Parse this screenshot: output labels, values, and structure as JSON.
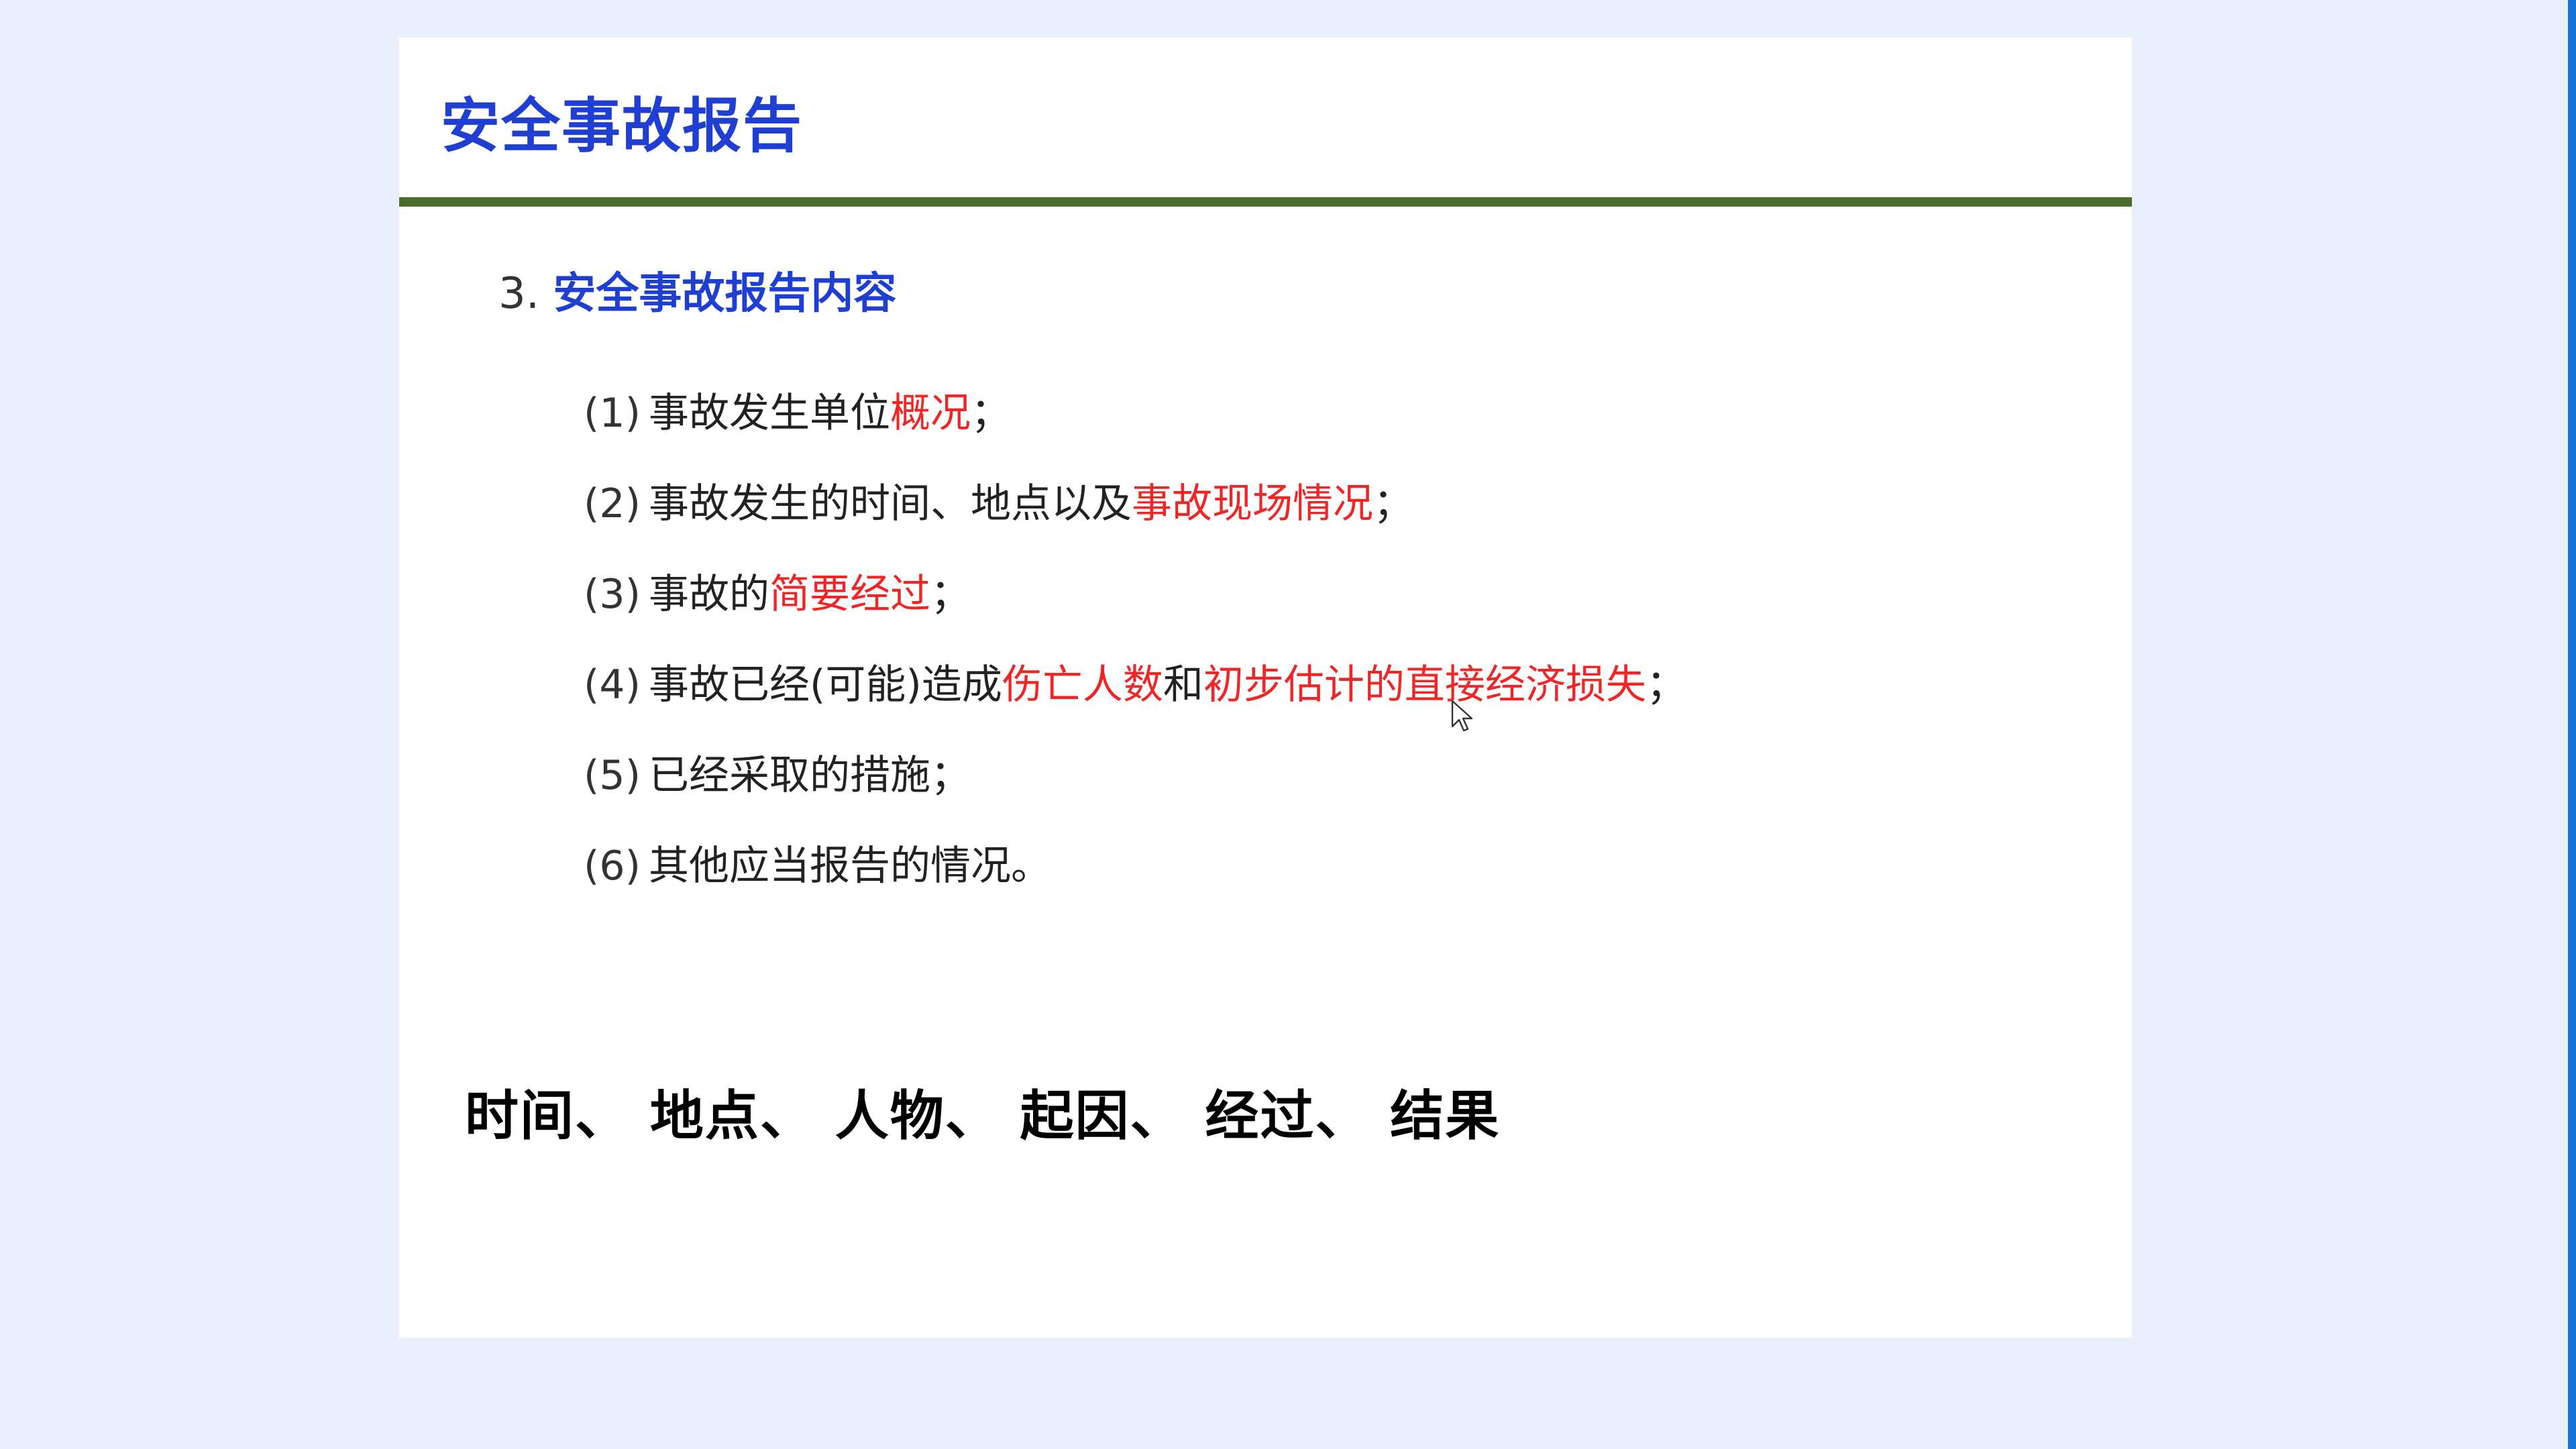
{
  "slide": {
    "title": "安全事故报告",
    "section": {
      "number": "3.",
      "heading": "安全事故报告内容"
    },
    "items": [
      {
        "num": "(1)",
        "segments": [
          {
            "text": "事故发生单位",
            "hl": false
          },
          {
            "text": "概况",
            "hl": true
          },
          {
            "text": "；",
            "hl": false
          }
        ]
      },
      {
        "num": "(2)",
        "segments": [
          {
            "text": "事故发生的时间、地点以及",
            "hl": false
          },
          {
            "text": "事故现场情况",
            "hl": true
          },
          {
            "text": "；",
            "hl": false
          }
        ]
      },
      {
        "num": "(3)",
        "segments": [
          {
            "text": "事故的",
            "hl": false
          },
          {
            "text": "简要经过",
            "hl": true
          },
          {
            "text": "；",
            "hl": false
          }
        ]
      },
      {
        "num": "(4)",
        "segments": [
          {
            "text": "事故已经(可能)造成",
            "hl": false
          },
          {
            "text": "伤亡人数",
            "hl": true
          },
          {
            "text": "和",
            "hl": false
          },
          {
            "text": "初步估计的直接经济损失",
            "hl": true
          },
          {
            "text": "；",
            "hl": false
          }
        ]
      },
      {
        "num": "(5)",
        "segments": [
          {
            "text": "已经采取的措施；",
            "hl": false
          }
        ]
      },
      {
        "num": "(6)",
        "segments": [
          {
            "text": "其他应当报告的情况。",
            "hl": false
          }
        ]
      }
    ],
    "summary": "时间、 地点、 人物、 起因、 经过、 结果"
  },
  "colors": {
    "title": "#1f3fd2",
    "highlight": "#f02626",
    "rule": "#4a6d2e",
    "background": "#eaf0fb",
    "edge_bar": "#1673d6"
  },
  "icons": {
    "cursor": "mouse-pointer-icon"
  }
}
